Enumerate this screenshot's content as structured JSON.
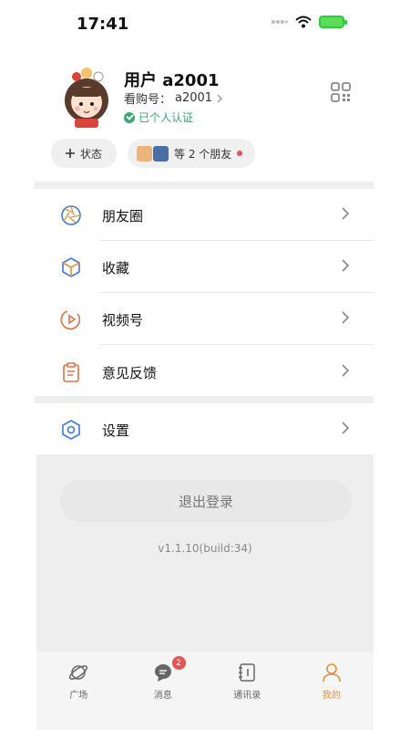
{
  "status_bar": {
    "time": "17:41",
    "icons": [
      "signal-dots-icon",
      "wifi-icon",
      "battery-charging-icon"
    ]
  },
  "profile": {
    "username": "用户 a2001",
    "account_label": "看购号：",
    "account_id": "a2001",
    "verified_text": "已个人认证",
    "avatar": "girl-avatar",
    "qr_icon": "qr-code-icon"
  },
  "status_pills": {
    "status_label": "状态",
    "friends_label": "等 2 个朋友"
  },
  "menu": [
    {
      "label": "朋友圈",
      "icon": "aperture-icon"
    },
    {
      "label": "收藏",
      "icon": "cube-icon"
    },
    {
      "label": "视频号",
      "icon": "play-circle-icon"
    },
    {
      "label": "意见反馈",
      "icon": "clipboard-icon"
    },
    {
      "label": "设置",
      "icon": "hexagon-gear-icon"
    }
  ],
  "footer": {
    "logout_label": "退出登录",
    "version": "v1.1.10(build:34)"
  },
  "tabs": [
    {
      "label": "广场",
      "icon": "planet-icon",
      "active": false
    },
    {
      "label": "消息",
      "icon": "chat-icon",
      "active": false,
      "badge": "2"
    },
    {
      "label": "通讯录",
      "icon": "contacts-book-icon",
      "active": false
    },
    {
      "label": "我的",
      "icon": "user-icon",
      "active": true
    }
  ],
  "colors": {
    "accent": "#e0923a",
    "verified": "#3aa76d",
    "badge": "#e55353"
  }
}
